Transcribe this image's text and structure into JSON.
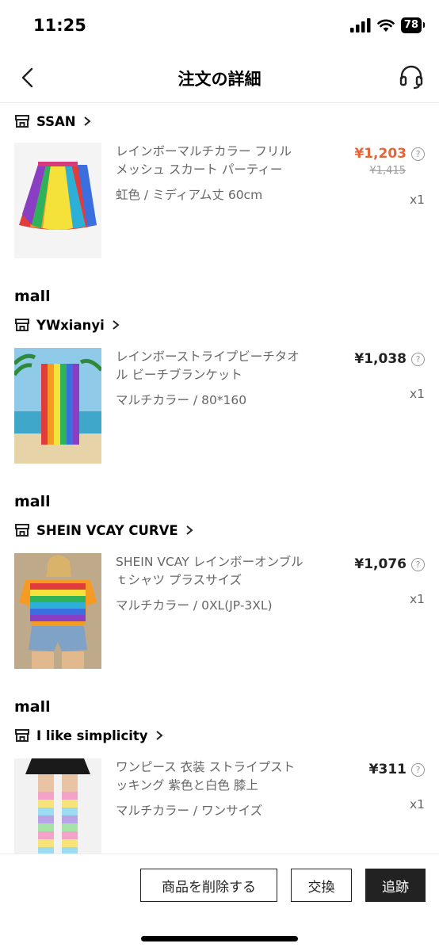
{
  "status_bar": {
    "time": "11:25",
    "battery": "78"
  },
  "header": {
    "title": "注文の詳細"
  },
  "groups": [
    {
      "mall_label": "",
      "store": "SSAN",
      "item": {
        "name": "レインボーマルチカラー フリル メッシュ スカート パーティー",
        "variant": "虹色 / ミディアム丈 60cm",
        "price": "¥1,203",
        "original_price": "¥1,415",
        "qty": "x1",
        "price_color": "#e6643a"
      }
    },
    {
      "mall_label": "mall",
      "store": "YWxianyi",
      "item": {
        "name": "レインボーストライプビーチタオル ビーチブランケット",
        "variant": "マルチカラー / 80*160",
        "price": "¥1,038",
        "qty": "x1"
      }
    },
    {
      "mall_label": "mall",
      "store": "SHEIN VCAY CURVE",
      "item": {
        "name": "SHEIN VCAY レインボーオンブルｔシャツ プラスサイズ",
        "variant": "マルチカラー / 0XL(JP-3XL)",
        "price": "¥1,076",
        "qty": "x1"
      }
    },
    {
      "mall_label": "mall",
      "store": "I like simplicity",
      "item": {
        "name": "ワンピース 衣装 ストライプストッキング 紫色と白色 膝上",
        "variant": "マルチカラー / ワンサイズ",
        "price": "¥311",
        "qty": "x1"
      }
    }
  ],
  "actions": {
    "delete_label": "商品を削除する",
    "exchange_label": "交換",
    "track_label": "追跡"
  },
  "icons": {
    "back": "chevron-left-icon",
    "support": "headset-icon",
    "store": "store-icon",
    "help": "question-circle-icon"
  }
}
